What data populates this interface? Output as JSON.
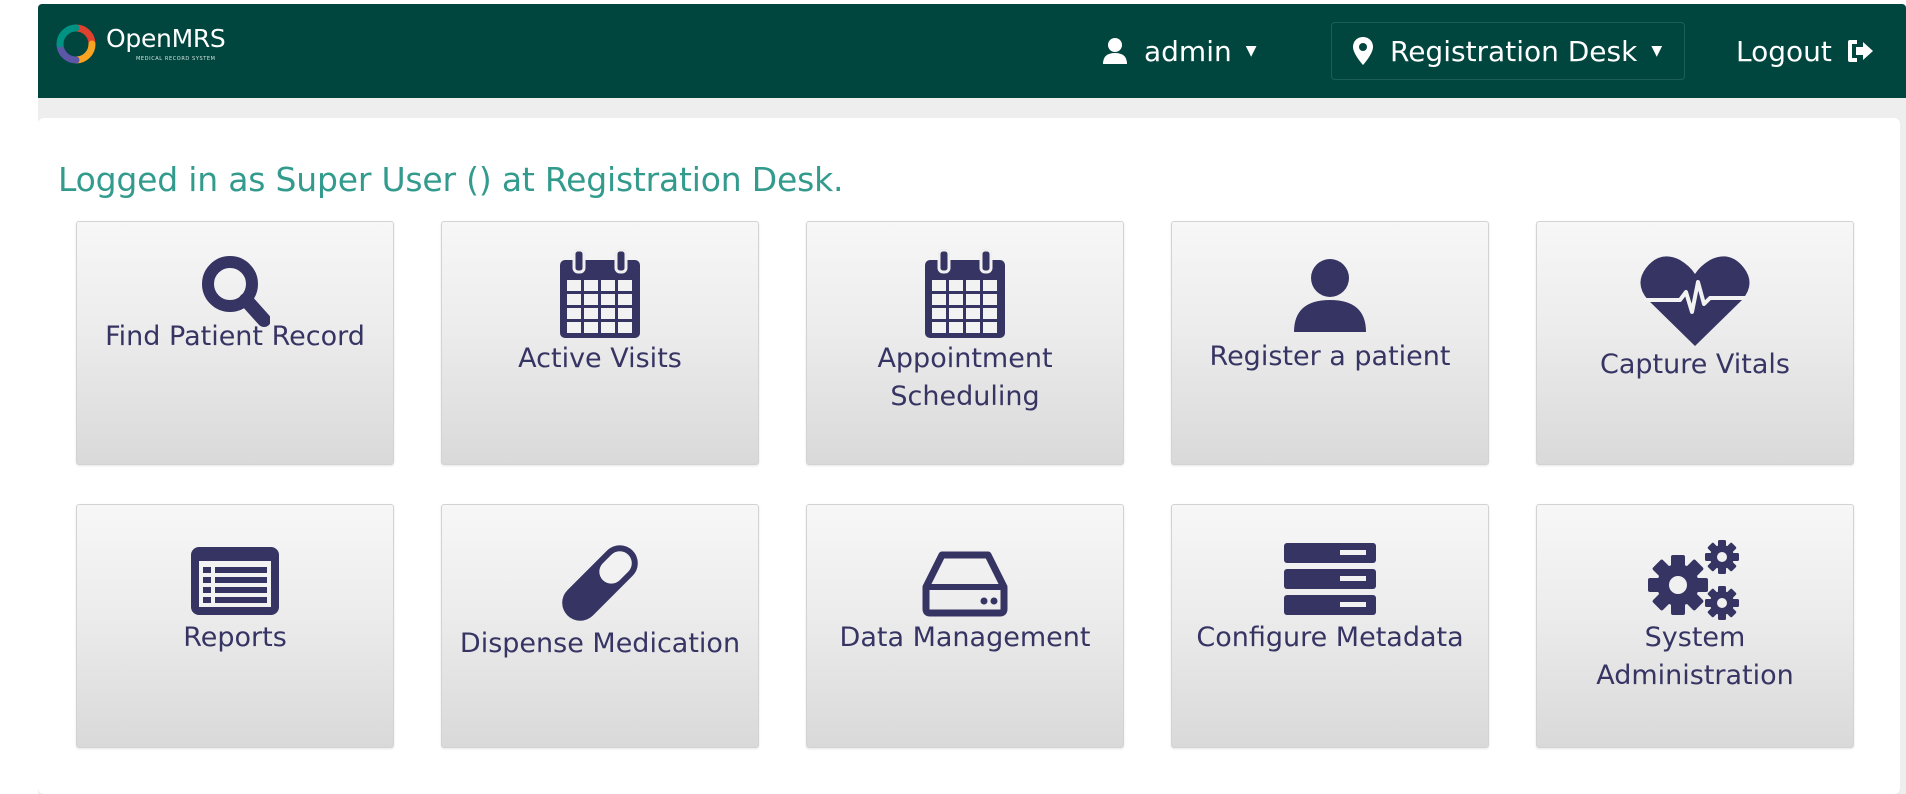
{
  "header": {
    "logo_text": "OpenMRS",
    "logo_subtext": "MEDICAL RECORD SYSTEM",
    "user_label": "admin",
    "location_label": "Registration Desk",
    "logout_label": "Logout",
    "background_color": "#00463f"
  },
  "main": {
    "welcome_text": "Logged in as Super User () at Registration Desk.",
    "accent_color": "#339b8d",
    "tiles": [
      {
        "label": "Find Patient Record",
        "icon": "search-icon"
      },
      {
        "label": "Active Visits",
        "icon": "calendar-icon"
      },
      {
        "label": "Appointment Scheduling",
        "icon": "calendar-icon"
      },
      {
        "label": "Register a patient",
        "icon": "user-icon"
      },
      {
        "label": "Capture Vitals",
        "icon": "heartbeat-icon"
      },
      {
        "label": "Reports",
        "icon": "list-alt-icon"
      },
      {
        "label": "Dispense Medication",
        "icon": "pill-icon"
      },
      {
        "label": "Data Management",
        "icon": "hdd-icon"
      },
      {
        "label": "Configure Metadata",
        "icon": "server-icon"
      },
      {
        "label": "System Administration",
        "icon": "cogs-icon"
      }
    ],
    "tile_text_color": "#363463"
  }
}
